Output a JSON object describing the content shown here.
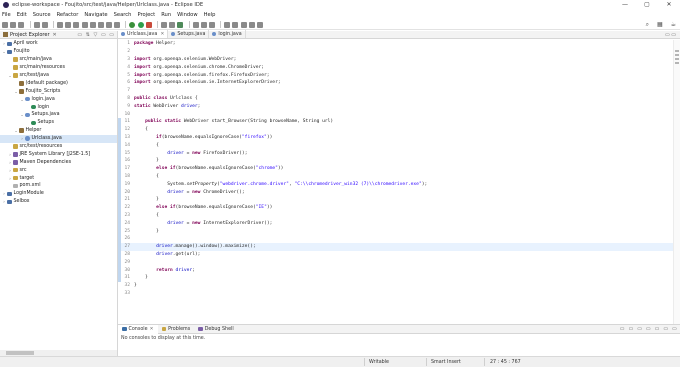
{
  "window": {
    "title": "eclipse-workspace - Foujito/src/test/java/Helper/Urlclass.java - Eclipse IDE",
    "controls": [
      "—",
      "▢",
      "✕"
    ]
  },
  "menu": [
    "File",
    "Edit",
    "Source",
    "Refactor",
    "Navigate",
    "Search",
    "Project",
    "Run",
    "Window",
    "Help"
  ],
  "toolbar_right": [
    "search-icon",
    "perspective-icon",
    "java-perspective-icon"
  ],
  "explorer": {
    "title": "Project Explorer",
    "close": "✕",
    "tools": "▭ ⇅ ▽ ▭ ▭",
    "items": [
      {
        "label": "April work",
        "depth": 0,
        "arrow": "›",
        "icon": "project"
      },
      {
        "label": "Foujito",
        "depth": 0,
        "arrow": "⌄",
        "icon": "project"
      },
      {
        "label": "src/main/java",
        "depth": 1,
        "arrow": "",
        "icon": "folder"
      },
      {
        "label": "src/main/resources",
        "depth": 1,
        "arrow": "",
        "icon": "folder"
      },
      {
        "label": "src/test/java",
        "depth": 1,
        "arrow": "⌄",
        "icon": "folder"
      },
      {
        "label": "(default package)",
        "depth": 2,
        "arrow": "",
        "icon": "package"
      },
      {
        "label": "Foujito_Scripts",
        "depth": 2,
        "arrow": "⌄",
        "icon": "package"
      },
      {
        "label": "login.java",
        "depth": 3,
        "arrow": "⌄",
        "icon": "java"
      },
      {
        "label": "login",
        "depth": 4,
        "arrow": "",
        "icon": "class"
      },
      {
        "label": "Setups.java",
        "depth": 3,
        "arrow": "⌄",
        "icon": "java"
      },
      {
        "label": "Setups",
        "depth": 4,
        "arrow": "",
        "icon": "class"
      },
      {
        "label": "Helper",
        "depth": 2,
        "arrow": "⌄",
        "icon": "package"
      },
      {
        "label": "Urlclass.java",
        "depth": 3,
        "arrow": "›",
        "icon": "java",
        "selected": true
      },
      {
        "label": "src/test/resources",
        "depth": 1,
        "arrow": "",
        "icon": "folder"
      },
      {
        "label": "JRE System Library [J2SE-1.5]",
        "depth": 1,
        "arrow": "›",
        "icon": "lib"
      },
      {
        "label": "Maven Dependencies",
        "depth": 1,
        "arrow": "›",
        "icon": "lib"
      },
      {
        "label": "src",
        "depth": 1,
        "arrow": "›",
        "icon": "folder"
      },
      {
        "label": "target",
        "depth": 1,
        "arrow": "›",
        "icon": "folder"
      },
      {
        "label": "pom.xml",
        "depth": 1,
        "arrow": "",
        "icon": "file"
      },
      {
        "label": "LoginModule",
        "depth": 0,
        "arrow": "›",
        "icon": "project"
      },
      {
        "label": "Selbox",
        "depth": 0,
        "arrow": "›",
        "icon": "project"
      }
    ]
  },
  "editor": {
    "tabs": [
      {
        "label": "Urlclass.java",
        "active": true
      },
      {
        "label": "Setups.java",
        "active": false
      },
      {
        "label": "login.java",
        "active": false
      }
    ],
    "tab_close": "✕",
    "maximize": "▭ ▭",
    "current_line": 27,
    "lines": [
      "package Helper;",
      "",
      "import org.openqa.selenium.WebDriver;",
      "import org.openqa.selenium.chrome.ChromeDriver;",
      "import org.openqa.selenium.firefox.FirefoxDriver;",
      "import org.openqa.selenium.ie.InternetExplorerDriver;",
      "",
      "public class Urlclass {",
      "static WebDriver driver;",
      "",
      "    public static WebDriver start_Browser(String browseName, String url)",
      "    {",
      "        if(browseName.equalsIgnoreCase(\"firefox\"))",
      "        {",
      "            driver = new FirefoxDriver();",
      "        }",
      "        else if(browseName.equalsIgnoreCase(\"chrome\"))",
      "        {",
      "            System.setProperty(\"webdriver.chrome.driver\", \"C:\\\\chromedriver_win32 (7)\\\\chromedriver.exe\");",
      "            driver = new ChromeDriver();",
      "        }",
      "        else if(browseName.equalsIgnoreCase(\"IE\"))",
      "        {",
      "            driver = new InternetExplorerDriver();",
      "        }",
      "",
      "        driver.manage().window().maximize();",
      "        driver.get(url);",
      "",
      "        return driver;",
      "    }",
      "}",
      ""
    ]
  },
  "console": {
    "tabs": [
      {
        "label": "Console",
        "active": true
      },
      {
        "label": "Problems",
        "active": false
      },
      {
        "label": "Debug Shell",
        "active": false
      }
    ],
    "tab_close": "✕",
    "tools": "▭ ▭ ▭ ▭ ▭ ▭ ▭",
    "message": "No consoles to display at this time."
  },
  "status": {
    "writable": "Writable",
    "insert_mode": "Smart Insert",
    "position": "27 : 45 : 767"
  }
}
